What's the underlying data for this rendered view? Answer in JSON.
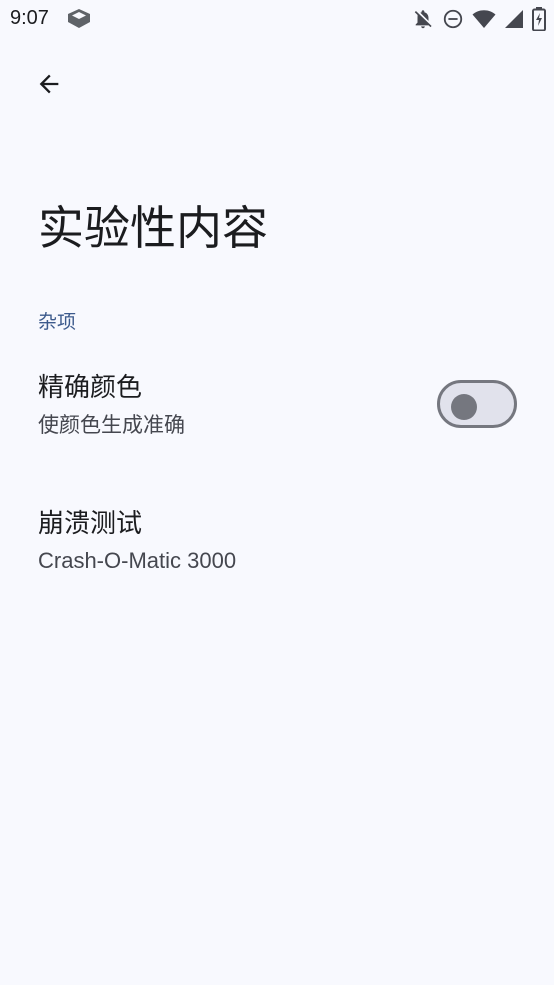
{
  "status_bar": {
    "time": "9:07",
    "icons": [
      "app-notification-icon",
      "notifications-off-icon",
      "do-not-disturb-icon",
      "wifi-icon",
      "signal-icon",
      "battery-charging-icon"
    ]
  },
  "toolbar": {
    "back_icon": "arrow-back-icon"
  },
  "page": {
    "title": "实验性内容"
  },
  "sections": [
    {
      "header": "杂项",
      "items": [
        {
          "title": "精确颜色",
          "summary": "使颜色生成准确",
          "widget": "switch",
          "checked": false
        },
        {
          "title": "崩溃测试",
          "summary": "Crash-O-Matic 3000"
        }
      ]
    }
  ],
  "colors": {
    "background": "#f8f9fe",
    "section_header": "#3c5a8c",
    "text_primary": "#1b1c1f",
    "text_secondary": "#45474f",
    "switch_outline": "#75777f",
    "switch_track_off": "#e1e2ec"
  }
}
